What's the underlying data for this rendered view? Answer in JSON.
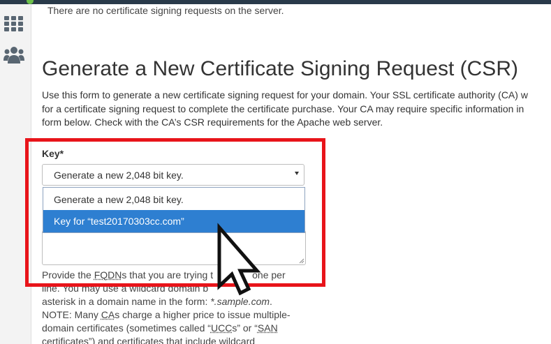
{
  "notice": "There are no certificate signing requests on the server.",
  "heading": "Generate a New Certificate Signing Request (CSR)",
  "intro": [
    "Use this form to generate a new certificate signing request for your domain. Your SSL certificate authority (CA) w",
    "for a certificate signing request to complete the certificate purchase. Your CA may require specific information in",
    "form below. Check with the CA’s CSR requirements for the Apache web server."
  ],
  "key": {
    "label": "Key*",
    "selected": "Generate a new 2,048 bit key.",
    "options": [
      "Generate a new 2,048 bit key.",
      "Key for “test20170303cc.com”"
    ]
  },
  "help": {
    "l1_a": "Provide the ",
    "l1_b": "FQDN",
    "l1_c": "s that you are trying t",
    "l1_d": "one per",
    "l2_a": "line. You may use a wildcard domain b",
    "l2_b": "n",
    "l3_a": "asterisk in a domain name in the form: ",
    "l3_b": "*.sample.com",
    "l3_c": ".",
    "l4_a": "NOTE: Many ",
    "l4_b": "CA",
    "l4_c": "s charge a higher price to issue multiple-",
    "l5": "domain certificates (sometimes called “",
    "l5_b": "UCC",
    "l5_c": "s” or “",
    "l5_d": "SAN",
    "l6": "certificates”) and certificates that include wildcard"
  },
  "icons": {
    "nav1": "apps-grid-icon",
    "nav2": "users-group-icon"
  },
  "colors": {
    "topbar": "#293a4a",
    "highlight": "#e8141a",
    "selected_option": "#2e7fd1"
  }
}
